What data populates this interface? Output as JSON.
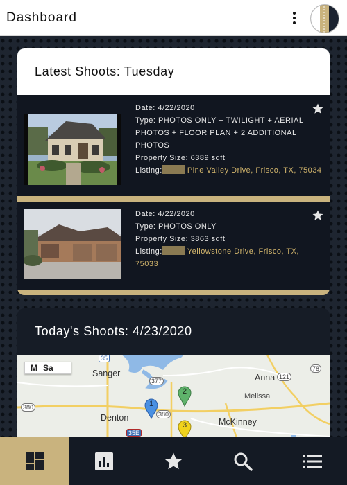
{
  "header": {
    "title": "Dashboard",
    "menu_icon": "more-vert-icon",
    "avatar_icon": "user-avatar"
  },
  "latest": {
    "title": "Latest Shoots: Tuesday",
    "shoots": [
      {
        "date": "Date: 4/22/2020",
        "type": "Type: PHOTOS ONLY + TWILIGHT + AERIAL PHOTOS + FLOOR PLAN + 2 ADDITIONAL PHOTOS",
        "size": "Property Size: 6389 sqft",
        "listing_label": "Listing:",
        "listing_address": "Pine Valley Drive, Frisco, TX, 75034",
        "favorite": true
      },
      {
        "date": "Date: 4/22/2020",
        "type": "Type: PHOTOS ONLY",
        "size": "Property Size: 3863 sqft",
        "listing_label": "Listing:",
        "listing_address": "Yellowstone Drive, Frisco, TX, 75033",
        "favorite": true
      }
    ]
  },
  "today": {
    "title": "Today's Shoots: 4/23/2020",
    "map": {
      "control_labels": [
        "M",
        "Sa"
      ],
      "places": [
        "Sanger",
        "Anna",
        "Melissa",
        "Denton",
        "McKinney"
      ],
      "roads": [
        "35",
        "377",
        "121",
        "78",
        "380",
        "380",
        "35E"
      ],
      "markers": [
        "1",
        "2",
        "3"
      ]
    }
  },
  "bottom_nav": {
    "items": [
      {
        "icon": "dashboard-icon",
        "active": true
      },
      {
        "icon": "bar-chart-icon",
        "active": false
      },
      {
        "icon": "star-icon",
        "active": false
      },
      {
        "icon": "search-icon",
        "active": false
      },
      {
        "icon": "list-icon",
        "active": false
      }
    ]
  },
  "colors": {
    "accent": "#c9b37e",
    "link": "#d2b56c",
    "card_dark": "#111620",
    "nav_bg": "#141a24"
  }
}
